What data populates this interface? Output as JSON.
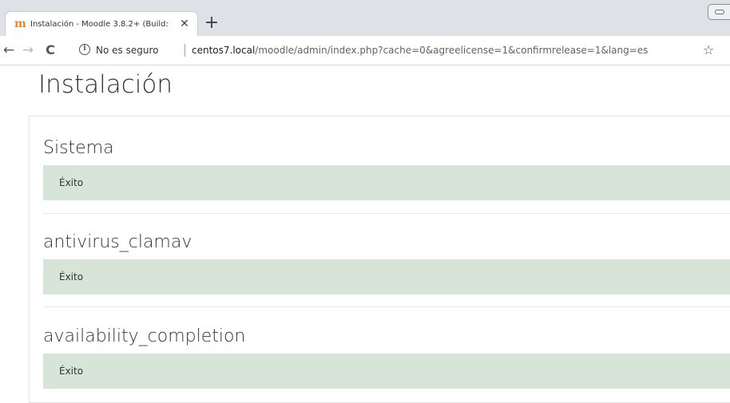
{
  "browser": {
    "tab_title": "Instalación - Moodle 3.8.2+ (Build:",
    "tab_favicon": "m",
    "not_secure": "No es seguro",
    "url_host": "centos7.local",
    "url_path": "/moodle/admin/index.php?cache=0&agreelicense=1&confirmrelease=1&lang=es"
  },
  "icons": {
    "close": "close-icon",
    "new_tab": "plus-icon",
    "back": "back-arrow-icon",
    "forward": "forward-arrow-icon",
    "reload": "reload-icon",
    "info": "info-icon",
    "bookmark": "star-icon"
  },
  "page": {
    "title": "Instalación",
    "sections": [
      {
        "name": "Sistema",
        "status": "Éxito"
      },
      {
        "name": "antivirus_clamav",
        "status": "Éxito"
      },
      {
        "name": "availability_completion",
        "status": "Éxito"
      }
    ]
  },
  "colors": {
    "success_background": "#d7e5d9",
    "moodle_orange": "#f98012"
  }
}
